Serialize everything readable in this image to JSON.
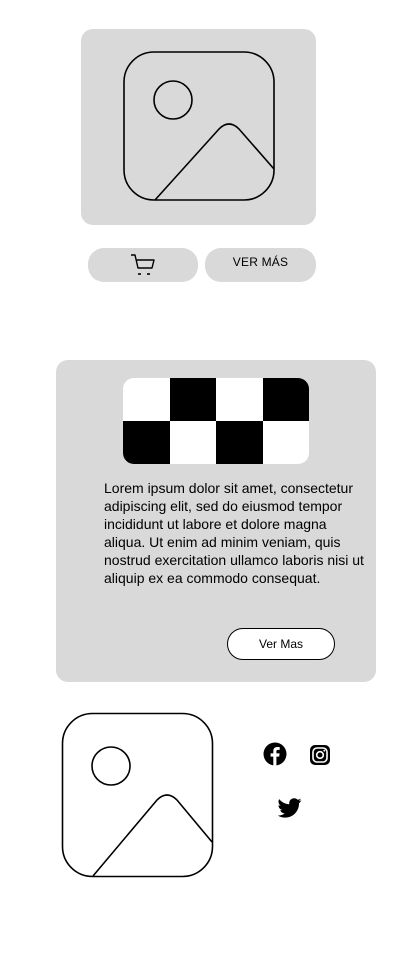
{
  "product": {
    "image_icon": "image-placeholder-icon",
    "cart_icon": "shopping-cart-icon",
    "ver_mas_label": "VER MÁS"
  },
  "info_card": {
    "checker_image": "checkerboard-image",
    "body_text": "Lorem ipsum dolor sit amet, consectetur adipiscing elit, sed do eiusmod tempor incididunt ut labore et dolore magna aliqua. Ut enim ad minim veniam, quis nostrud exercitation ullamco laboris nisi ut aliquip ex ea commodo consequat.",
    "button_label": "Ver Mas"
  },
  "footer": {
    "image_icon": "image-placeholder-icon",
    "social": [
      {
        "name": "facebook-icon"
      },
      {
        "name": "instagram-icon"
      },
      {
        "name": "twitter-icon"
      }
    ]
  },
  "colors": {
    "card_background": "#d9d9d9",
    "foreground": "#000000",
    "page_background": "#ffffff"
  }
}
